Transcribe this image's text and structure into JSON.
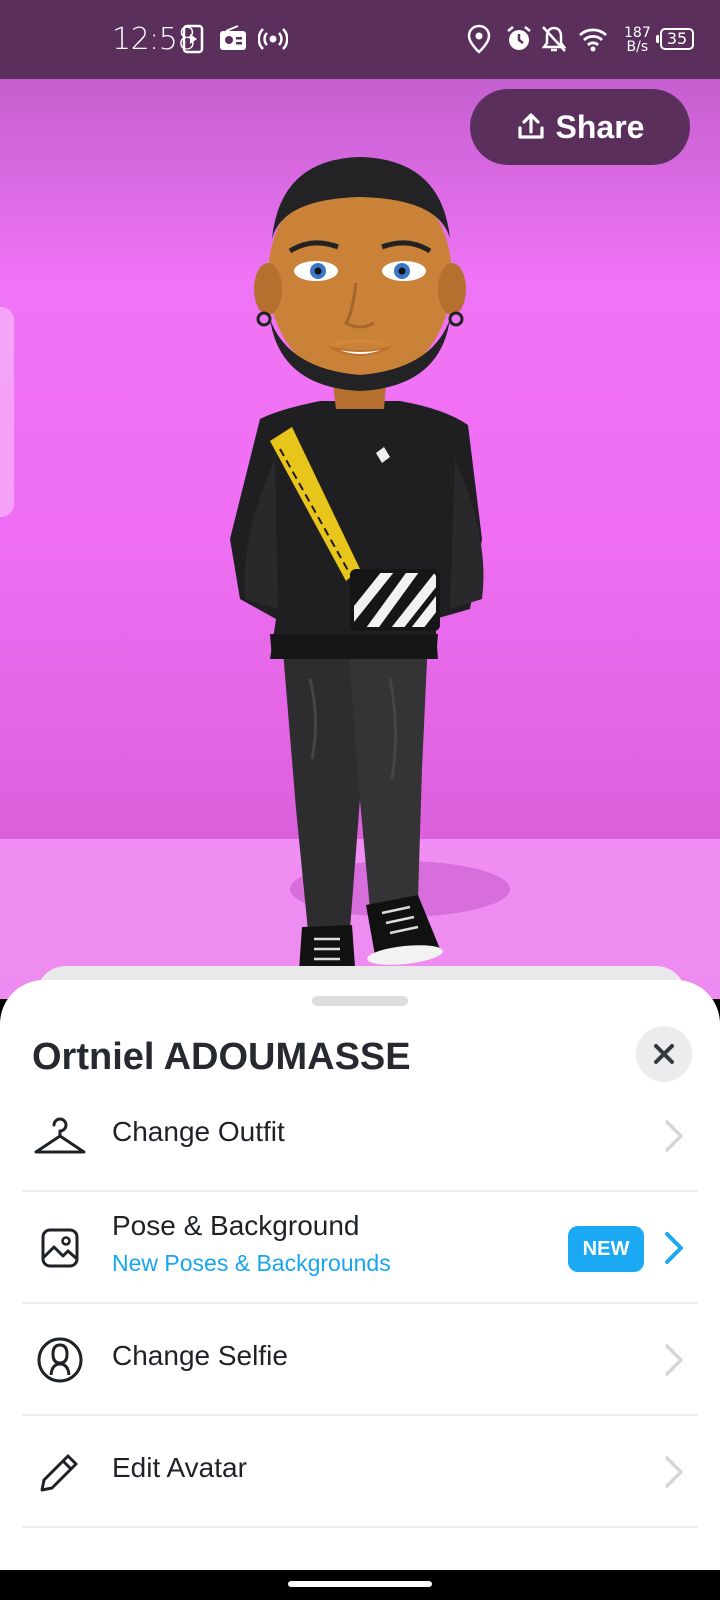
{
  "status_bar": {
    "time": "12:58",
    "net_speed_value": "187",
    "net_speed_unit": "B/s",
    "battery_level": "35",
    "icons": [
      "media-play-icon",
      "radio-icon",
      "hotspot-icon",
      "location-icon",
      "alarm-icon",
      "bell-off-icon",
      "wifi-icon",
      "battery-icon"
    ]
  },
  "scene": {
    "share_label": "Share",
    "share_icon": "upload-icon",
    "colors": {
      "background": "#f074f6",
      "share_button": "#5a2f5b",
      "status_bar": "#5a2f5b"
    }
  },
  "sheet": {
    "title": "Ortniel ADOUMASSE",
    "close_icon": "close-icon",
    "items": [
      {
        "label": "Change Outfit",
        "icon": "hanger-icon"
      },
      {
        "label": "Pose & Background",
        "subtitle": "New Poses & Backgrounds",
        "badge": "NEW",
        "icon": "image-icon"
      },
      {
        "label": "Change Selfie",
        "icon": "person-circle-icon"
      },
      {
        "label": "Edit Avatar",
        "icon": "pencil-icon"
      }
    ],
    "accent_color": "#1aa9f2"
  }
}
